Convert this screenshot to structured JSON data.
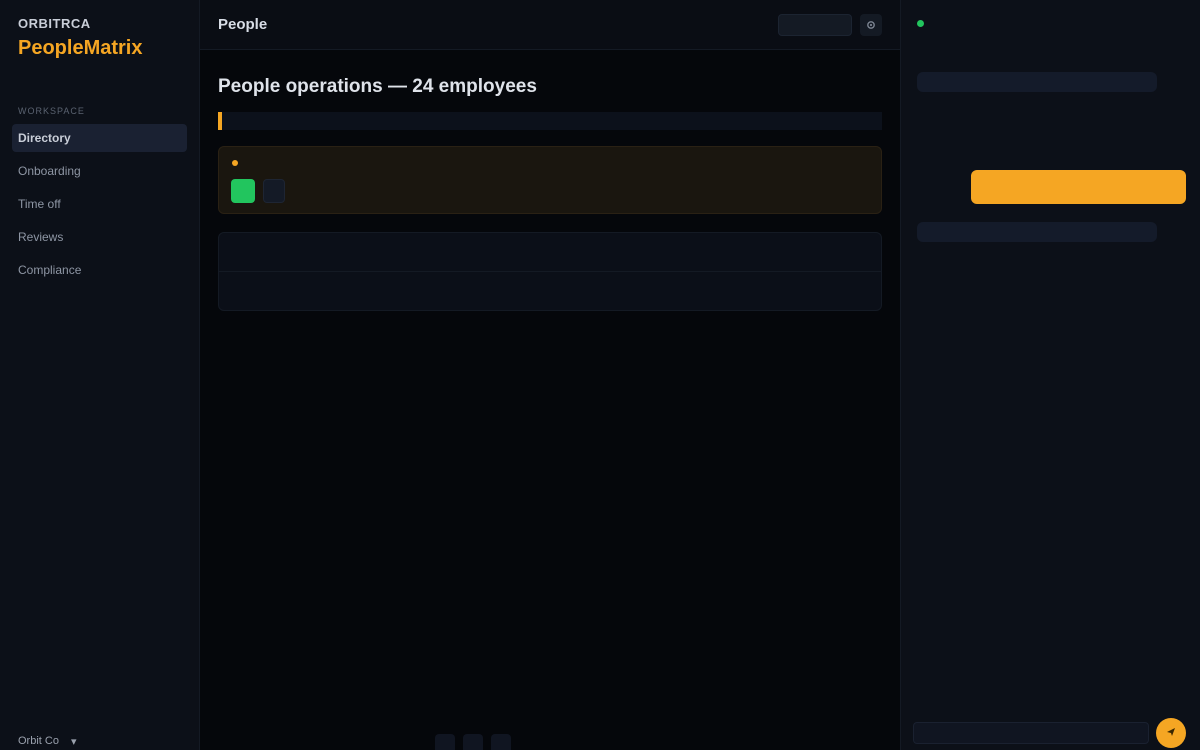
{
  "sidebar": {
    "org": "ORBITRCA",
    "brand": "PeopleMatrix",
    "sub": [
      "",
      ""
    ],
    "section": "WORKSPACE",
    "items": [
      {
        "label": "Directory",
        "active": true
      },
      {
        "label": "Onboarding"
      },
      {
        "label": "Time off"
      },
      {
        "label": "Reviews"
      },
      {
        "label": "Compliance"
      }
    ],
    "footer": [
      "Orbit Co",
      "▾"
    ]
  },
  "topbar": {
    "title": "People",
    "link": "",
    "search": "",
    "icon": "gear-icon"
  },
  "main": {
    "eyebrow": "",
    "title": "People operations — 24 employees",
    "banner_prefix": "",
    "banner_strong": "",
    "banner_suffix": "",
    "alert": {
      "tag": "",
      "title": "",
      "body": "",
      "approve": "",
      "secondary": ""
    },
    "people": [
      {
        "name": "",
        "role": "",
        "meta": ""
      },
      {
        "name": "",
        "role": "",
        "meta": ""
      },
      {
        "name": "",
        "role": "",
        "meta": ""
      },
      {
        "name": "",
        "role": "",
        "meta": ""
      },
      {
        "name": "",
        "role": "",
        "meta": ""
      },
      {
        "name": "",
        "role": "",
        "meta": ""
      }
    ],
    "footer": [
      "",
      "",
      ""
    ]
  },
  "panel": {
    "title": "",
    "msg1_label": "",
    "msg1": "",
    "cta": "",
    "msg2_label": "",
    "msg2": "",
    "input_placeholder": "",
    "send_icon": "send-icon"
  },
  "colors": {
    "accent": "#f5a623",
    "success": "#22c55e",
    "bg": "#05070b",
    "sidebar": "#0c1018"
  }
}
